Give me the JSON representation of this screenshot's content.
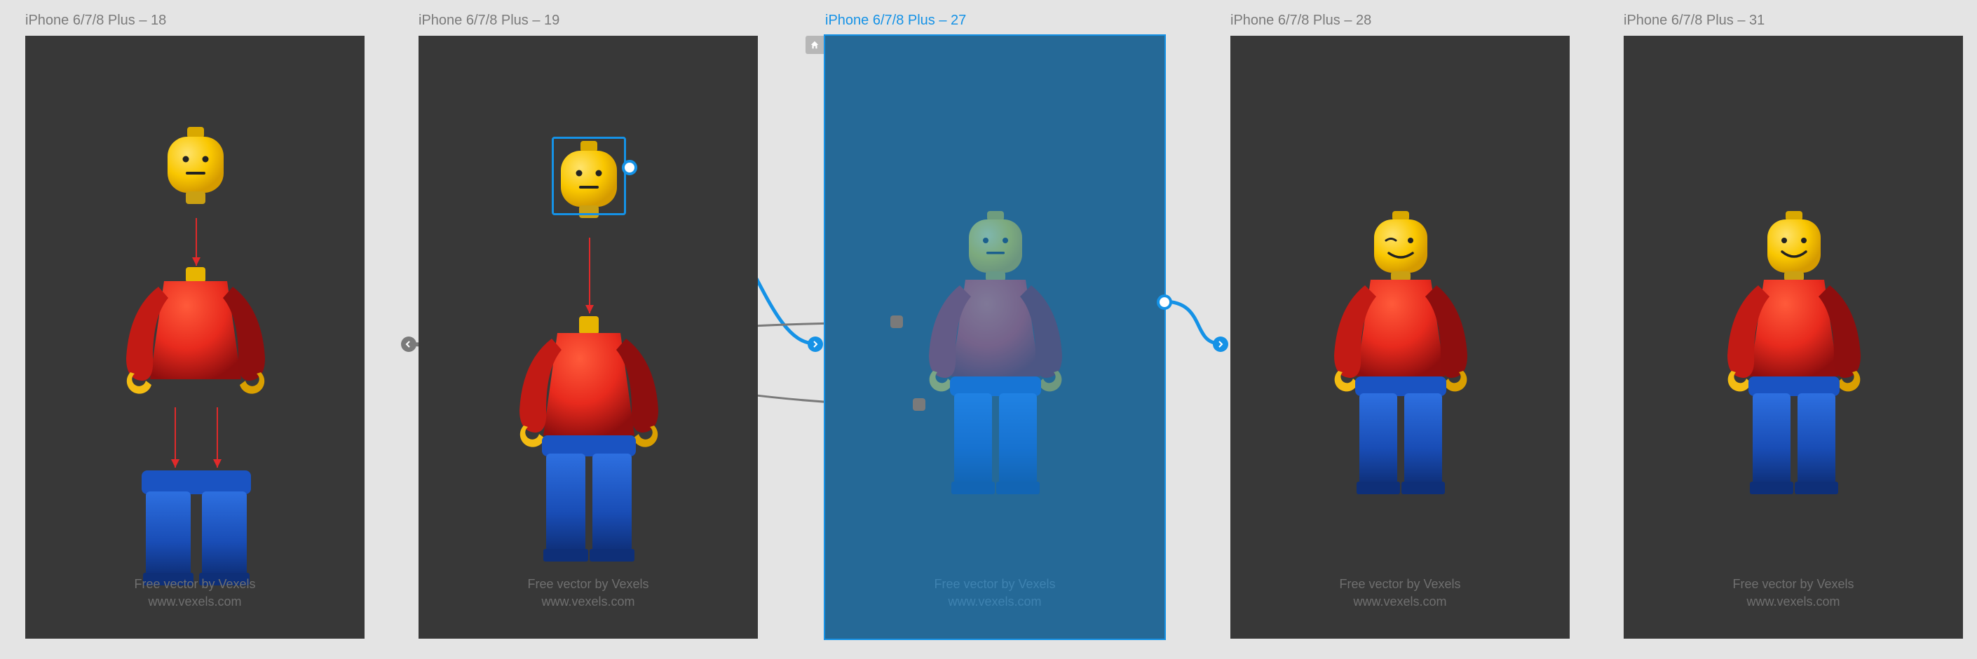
{
  "artboards": [
    {
      "label": "iPhone 6/7/8 Plus – 18",
      "selected": false
    },
    {
      "label": "iPhone 6/7/8 Plus – 19",
      "selected": false
    },
    {
      "label": "iPhone 6/7/8 Plus – 27",
      "selected": true
    },
    {
      "label": "iPhone 6/7/8 Plus – 28",
      "selected": false
    },
    {
      "label": "iPhone 6/7/8 Plus – 31",
      "selected": false
    }
  ],
  "credit": {
    "line1": "Free vector by Vexels",
    "line2": "www.vexels.com"
  },
  "colors": {
    "selection": "#1592e6",
    "canvas": "#e4e4e4",
    "artboard": "#383838"
  }
}
